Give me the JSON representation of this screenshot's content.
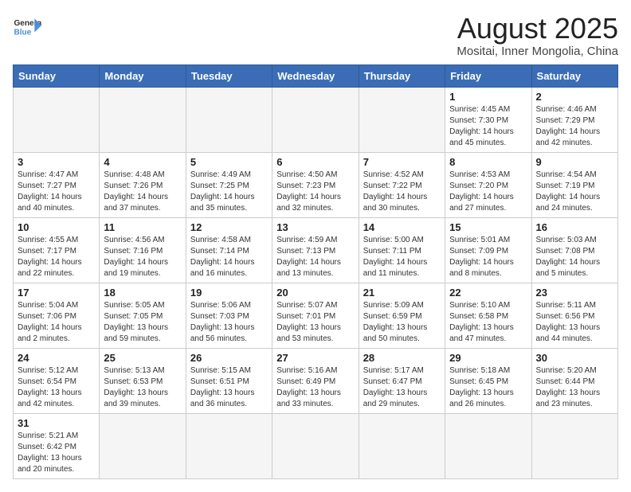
{
  "header": {
    "logo_general": "General",
    "logo_blue": "Blue",
    "title": "August 2025",
    "subtitle": "Mositai, Inner Mongolia, China"
  },
  "weekdays": [
    "Sunday",
    "Monday",
    "Tuesday",
    "Wednesday",
    "Thursday",
    "Friday",
    "Saturday"
  ],
  "weeks": [
    [
      {
        "day": "",
        "info": ""
      },
      {
        "day": "",
        "info": ""
      },
      {
        "day": "",
        "info": ""
      },
      {
        "day": "",
        "info": ""
      },
      {
        "day": "",
        "info": ""
      },
      {
        "day": "1",
        "info": "Sunrise: 4:45 AM\nSunset: 7:30 PM\nDaylight: 14 hours and 45 minutes."
      },
      {
        "day": "2",
        "info": "Sunrise: 4:46 AM\nSunset: 7:29 PM\nDaylight: 14 hours and 42 minutes."
      }
    ],
    [
      {
        "day": "3",
        "info": "Sunrise: 4:47 AM\nSunset: 7:27 PM\nDaylight: 14 hours and 40 minutes."
      },
      {
        "day": "4",
        "info": "Sunrise: 4:48 AM\nSunset: 7:26 PM\nDaylight: 14 hours and 37 minutes."
      },
      {
        "day": "5",
        "info": "Sunrise: 4:49 AM\nSunset: 7:25 PM\nDaylight: 14 hours and 35 minutes."
      },
      {
        "day": "6",
        "info": "Sunrise: 4:50 AM\nSunset: 7:23 PM\nDaylight: 14 hours and 32 minutes."
      },
      {
        "day": "7",
        "info": "Sunrise: 4:52 AM\nSunset: 7:22 PM\nDaylight: 14 hours and 30 minutes."
      },
      {
        "day": "8",
        "info": "Sunrise: 4:53 AM\nSunset: 7:20 PM\nDaylight: 14 hours and 27 minutes."
      },
      {
        "day": "9",
        "info": "Sunrise: 4:54 AM\nSunset: 7:19 PM\nDaylight: 14 hours and 24 minutes."
      }
    ],
    [
      {
        "day": "10",
        "info": "Sunrise: 4:55 AM\nSunset: 7:17 PM\nDaylight: 14 hours and 22 minutes."
      },
      {
        "day": "11",
        "info": "Sunrise: 4:56 AM\nSunset: 7:16 PM\nDaylight: 14 hours and 19 minutes."
      },
      {
        "day": "12",
        "info": "Sunrise: 4:58 AM\nSunset: 7:14 PM\nDaylight: 14 hours and 16 minutes."
      },
      {
        "day": "13",
        "info": "Sunrise: 4:59 AM\nSunset: 7:13 PM\nDaylight: 14 hours and 13 minutes."
      },
      {
        "day": "14",
        "info": "Sunrise: 5:00 AM\nSunset: 7:11 PM\nDaylight: 14 hours and 11 minutes."
      },
      {
        "day": "15",
        "info": "Sunrise: 5:01 AM\nSunset: 7:09 PM\nDaylight: 14 hours and 8 minutes."
      },
      {
        "day": "16",
        "info": "Sunrise: 5:03 AM\nSunset: 7:08 PM\nDaylight: 14 hours and 5 minutes."
      }
    ],
    [
      {
        "day": "17",
        "info": "Sunrise: 5:04 AM\nSunset: 7:06 PM\nDaylight: 14 hours and 2 minutes."
      },
      {
        "day": "18",
        "info": "Sunrise: 5:05 AM\nSunset: 7:05 PM\nDaylight: 13 hours and 59 minutes."
      },
      {
        "day": "19",
        "info": "Sunrise: 5:06 AM\nSunset: 7:03 PM\nDaylight: 13 hours and 56 minutes."
      },
      {
        "day": "20",
        "info": "Sunrise: 5:07 AM\nSunset: 7:01 PM\nDaylight: 13 hours and 53 minutes."
      },
      {
        "day": "21",
        "info": "Sunrise: 5:09 AM\nSunset: 6:59 PM\nDaylight: 13 hours and 50 minutes."
      },
      {
        "day": "22",
        "info": "Sunrise: 5:10 AM\nSunset: 6:58 PM\nDaylight: 13 hours and 47 minutes."
      },
      {
        "day": "23",
        "info": "Sunrise: 5:11 AM\nSunset: 6:56 PM\nDaylight: 13 hours and 44 minutes."
      }
    ],
    [
      {
        "day": "24",
        "info": "Sunrise: 5:12 AM\nSunset: 6:54 PM\nDaylight: 13 hours and 42 minutes."
      },
      {
        "day": "25",
        "info": "Sunrise: 5:13 AM\nSunset: 6:53 PM\nDaylight: 13 hours and 39 minutes."
      },
      {
        "day": "26",
        "info": "Sunrise: 5:15 AM\nSunset: 6:51 PM\nDaylight: 13 hours and 36 minutes."
      },
      {
        "day": "27",
        "info": "Sunrise: 5:16 AM\nSunset: 6:49 PM\nDaylight: 13 hours and 33 minutes."
      },
      {
        "day": "28",
        "info": "Sunrise: 5:17 AM\nSunset: 6:47 PM\nDaylight: 13 hours and 29 minutes."
      },
      {
        "day": "29",
        "info": "Sunrise: 5:18 AM\nSunset: 6:45 PM\nDaylight: 13 hours and 26 minutes."
      },
      {
        "day": "30",
        "info": "Sunrise: 5:20 AM\nSunset: 6:44 PM\nDaylight: 13 hours and 23 minutes."
      }
    ],
    [
      {
        "day": "31",
        "info": "Sunrise: 5:21 AM\nSunset: 6:42 PM\nDaylight: 13 hours and 20 minutes."
      },
      {
        "day": "",
        "info": ""
      },
      {
        "day": "",
        "info": ""
      },
      {
        "day": "",
        "info": ""
      },
      {
        "day": "",
        "info": ""
      },
      {
        "day": "",
        "info": ""
      },
      {
        "day": "",
        "info": ""
      }
    ]
  ]
}
